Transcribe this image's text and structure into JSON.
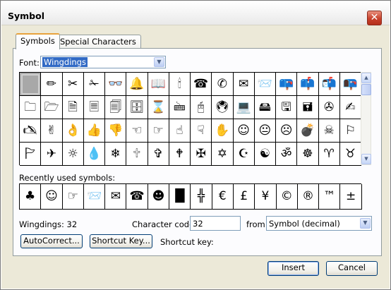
{
  "window": {
    "title": "Symbol",
    "close_glyph": "✕"
  },
  "tabs": [
    {
      "label": "Symbols",
      "active": true
    },
    {
      "label": "Special Characters",
      "active": false
    }
  ],
  "font": {
    "label": "Font:",
    "value": "Wingdings"
  },
  "symbols": [
    " ",
    "✏",
    "✂",
    "✁",
    "👓",
    "🔔",
    "📖",
    "🕯",
    "☎",
    "✆",
    "✉",
    "📨",
    "📪",
    "📫",
    "📬",
    "📭",
    "🗀",
    "🗁",
    "🗎",
    "🗏",
    "🗐",
    "🗄",
    "⌛",
    "🖮",
    "🖰",
    "🖲",
    "💻",
    "🖴",
    "🖫",
    "🖬",
    "✇",
    "✍",
    "🖎",
    "✌",
    "👌",
    "👍",
    "👎",
    "☜",
    "☞",
    "☝",
    "☟",
    "✋",
    "☺",
    "😐",
    "☹",
    "💣",
    "☠",
    "⚐",
    "🏱",
    "✈",
    "☼",
    "💧",
    "❄",
    "🕆",
    "✞",
    "🕈",
    "✠",
    "✡",
    "☪",
    "☯",
    "ॐ",
    "☸",
    "♈",
    "♉"
  ],
  "recent": {
    "label": "Recently used symbols:",
    "items": [
      "♣",
      "☺",
      "☞",
      "📨",
      "✉",
      "☎",
      "☻",
      "█",
      "╬",
      "€",
      "£",
      "¥",
      "©",
      "®",
      "™",
      "±"
    ]
  },
  "status": {
    "char_name": "Wingdings: 32"
  },
  "char_code": {
    "label": "Character code:",
    "value": "32"
  },
  "from": {
    "label": "from:",
    "value": "Symbol (decimal)"
  },
  "buttons": {
    "autocorrect": "AutoCorrect...",
    "shortcut_key": "Shortcut Key...",
    "insert": "Insert",
    "cancel": "Cancel"
  },
  "shortcut_key_label": "Shortcut key:",
  "scroll": {
    "up": "▲",
    "down": "▼",
    "dropdown": "▼"
  }
}
